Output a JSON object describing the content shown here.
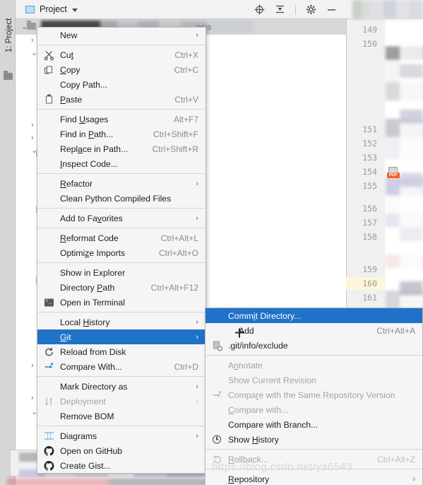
{
  "window": {
    "tool_window_label": "1: Project",
    "project_label": "Project",
    "toolbar_icons": [
      "locate-icon",
      "collapse-all-icon",
      "settings-gear-icon",
      "minimize-icon"
    ]
  },
  "tree": {
    "visible_word": "esis"
  },
  "gutter": {
    "line_numbers": [
      "149",
      "150",
      "151",
      "152",
      "153",
      "154",
      "155",
      "156",
      "157",
      "158",
      "159",
      "160",
      "161"
    ],
    "highlighted_line": "160",
    "pdf_badge_line": "154"
  },
  "context_menu": {
    "items": [
      {
        "label": "New",
        "accel": "",
        "arrow": true,
        "icon": "",
        "disabled": false,
        "selected": false,
        "mnemonic": ""
      },
      {
        "separator": true
      },
      {
        "label": "Cut",
        "accel": "Ctrl+X",
        "arrow": false,
        "icon": "scissors-icon",
        "disabled": false,
        "selected": false,
        "mnemonic": "t"
      },
      {
        "label": "Copy",
        "accel": "Ctrl+C",
        "arrow": false,
        "icon": "copy-icon",
        "disabled": false,
        "selected": false,
        "mnemonic": "C"
      },
      {
        "label": "Copy Path...",
        "accel": "",
        "arrow": false,
        "icon": "",
        "disabled": false,
        "selected": false,
        "mnemonic": ""
      },
      {
        "label": "Paste",
        "accel": "Ctrl+V",
        "arrow": false,
        "icon": "paste-icon",
        "disabled": false,
        "selected": false,
        "mnemonic": "P"
      },
      {
        "separator": true
      },
      {
        "label": "Find Usages",
        "accel": "Alt+F7",
        "arrow": false,
        "icon": "",
        "disabled": false,
        "selected": false,
        "mnemonic": "U"
      },
      {
        "label": "Find in Path...",
        "accel": "Ctrl+Shift+F",
        "arrow": false,
        "icon": "",
        "disabled": false,
        "selected": false,
        "mnemonic": "P"
      },
      {
        "label": "Replace in Path...",
        "accel": "Ctrl+Shift+R",
        "arrow": false,
        "icon": "",
        "disabled": false,
        "selected": false,
        "mnemonic": "a"
      },
      {
        "label": "Inspect Code...",
        "accel": "",
        "arrow": false,
        "icon": "",
        "disabled": false,
        "selected": false,
        "mnemonic": "I"
      },
      {
        "separator": true
      },
      {
        "label": "Refactor",
        "accel": "",
        "arrow": true,
        "icon": "",
        "disabled": false,
        "selected": false,
        "mnemonic": "R"
      },
      {
        "label": "Clean Python Compiled Files",
        "accel": "",
        "arrow": false,
        "icon": "",
        "disabled": false,
        "selected": false,
        "mnemonic": ""
      },
      {
        "separator": true
      },
      {
        "label": "Add to Favorites",
        "accel": "",
        "arrow": true,
        "icon": "",
        "disabled": false,
        "selected": false,
        "mnemonic": "v"
      },
      {
        "separator": true
      },
      {
        "label": "Reformat Code",
        "accel": "Ctrl+Alt+L",
        "arrow": false,
        "icon": "",
        "disabled": false,
        "selected": false,
        "mnemonic": "R"
      },
      {
        "label": "Optimize Imports",
        "accel": "Ctrl+Alt+O",
        "arrow": false,
        "icon": "",
        "disabled": false,
        "selected": false,
        "mnemonic": "z"
      },
      {
        "separator": true
      },
      {
        "label": "Show in Explorer",
        "accel": "",
        "arrow": false,
        "icon": "",
        "disabled": false,
        "selected": false,
        "mnemonic": ""
      },
      {
        "label": "Directory Path",
        "accel": "Ctrl+Alt+F12",
        "arrow": false,
        "icon": "",
        "disabled": false,
        "selected": false,
        "mnemonic": "P"
      },
      {
        "label": "Open in Terminal",
        "accel": "",
        "arrow": false,
        "icon": "terminal-icon",
        "disabled": false,
        "selected": false,
        "mnemonic": ""
      },
      {
        "separator": true
      },
      {
        "label": "Local History",
        "accel": "",
        "arrow": true,
        "icon": "",
        "disabled": false,
        "selected": false,
        "mnemonic": "H"
      },
      {
        "label": "Git",
        "accel": "",
        "arrow": true,
        "icon": "",
        "disabled": false,
        "selected": true,
        "mnemonic": "G"
      },
      {
        "label": "Reload from Disk",
        "accel": "",
        "arrow": false,
        "icon": "reload-icon",
        "disabled": false,
        "selected": false,
        "mnemonic": ""
      },
      {
        "label": "Compare With...",
        "accel": "Ctrl+D",
        "arrow": false,
        "icon": "compare-icon",
        "disabled": false,
        "selected": false,
        "mnemonic": ""
      },
      {
        "separator": true
      },
      {
        "label": "Mark Directory as",
        "accel": "",
        "arrow": true,
        "icon": "",
        "disabled": false,
        "selected": false,
        "mnemonic": ""
      },
      {
        "label": "Deployment",
        "accel": "",
        "arrow": true,
        "icon": "deployment-icon",
        "disabled": true,
        "selected": false,
        "mnemonic": ""
      },
      {
        "label": "Remove BOM",
        "accel": "",
        "arrow": false,
        "icon": "",
        "disabled": false,
        "selected": false,
        "mnemonic": ""
      },
      {
        "separator": true
      },
      {
        "label": "Diagrams",
        "accel": "",
        "arrow": true,
        "icon": "diagram-icon",
        "disabled": false,
        "selected": false,
        "mnemonic": ""
      },
      {
        "label": "Open on GitHub",
        "accel": "",
        "arrow": false,
        "icon": "github-icon",
        "disabled": false,
        "selected": false,
        "mnemonic": ""
      },
      {
        "label": "Create Gist...",
        "accel": "",
        "arrow": false,
        "icon": "github-icon",
        "disabled": false,
        "selected": false,
        "mnemonic": ""
      }
    ]
  },
  "git_submenu": {
    "items": [
      {
        "label": "Commit Directory...",
        "accel": "",
        "arrow": false,
        "icon": "",
        "disabled": false,
        "selected": true,
        "mnemonic": "i"
      },
      {
        "label": "Add",
        "accel": "Ctrl+Alt+A",
        "arrow": false,
        "icon": "plus-icon",
        "disabled": false,
        "selected": false,
        "mnemonic": ""
      },
      {
        "label": ".git/info/exclude",
        "accel": "",
        "arrow": false,
        "icon": "git-exclude-icon",
        "disabled": false,
        "selected": false,
        "mnemonic": ""
      },
      {
        "separator": true
      },
      {
        "label": "Annotate",
        "accel": "",
        "arrow": false,
        "icon": "",
        "disabled": true,
        "selected": false,
        "mnemonic": "n"
      },
      {
        "label": "Show Current Revision",
        "accel": "",
        "arrow": false,
        "icon": "",
        "disabled": true,
        "selected": false,
        "mnemonic": ""
      },
      {
        "label": "Compare with the Same Repository Version",
        "accel": "",
        "arrow": false,
        "icon": "compare-grey-icon",
        "disabled": true,
        "selected": false,
        "mnemonic": "r"
      },
      {
        "label": "Compare with...",
        "accel": "",
        "arrow": false,
        "icon": "",
        "disabled": true,
        "selected": false,
        "mnemonic": "C"
      },
      {
        "label": "Compare with Branch...",
        "accel": "",
        "arrow": false,
        "icon": "",
        "disabled": false,
        "selected": false,
        "mnemonic": ""
      },
      {
        "label": "Show History",
        "accel": "",
        "arrow": false,
        "icon": "history-icon",
        "disabled": false,
        "selected": false,
        "mnemonic": "H"
      },
      {
        "separator": true
      },
      {
        "label": "Rollback...",
        "accel": "Ctrl+Alt+Z",
        "arrow": false,
        "icon": "rollback-icon",
        "disabled": true,
        "selected": false,
        "mnemonic": "R"
      },
      {
        "separator": true
      },
      {
        "label": "Repository",
        "accel": "",
        "arrow": true,
        "icon": "",
        "disabled": false,
        "selected": false,
        "mnemonic": "R"
      }
    ]
  },
  "watermark": {
    "text": "https://blog.csdn.net/ya6543"
  },
  "colors": {
    "selection_blue": "#1f72c7",
    "menu_bg": "#f5f5f5",
    "menu_border": "#b9b9b9",
    "accel_grey": "#8a8a8a",
    "disabled_grey": "#a3a3a3",
    "highlight_line_yellow": "#fdf6dd",
    "pdf_orange": "#f0622b"
  }
}
